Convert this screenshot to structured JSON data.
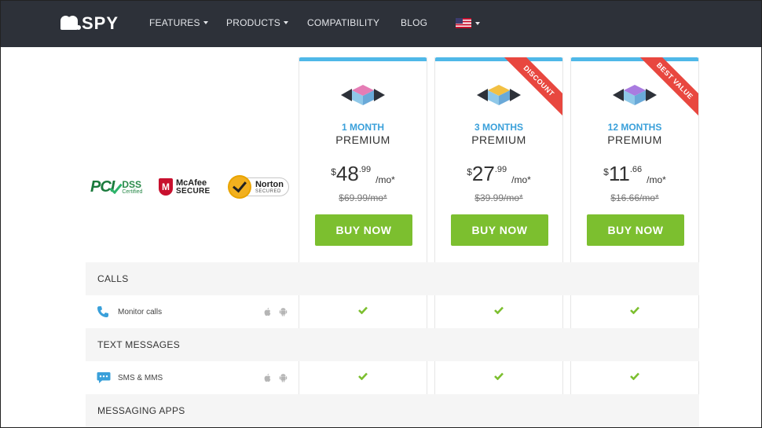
{
  "nav": {
    "logo": "SPY",
    "items": [
      {
        "label": "FEATURES",
        "dropdown": true
      },
      {
        "label": "PRODUCTS",
        "dropdown": true
      },
      {
        "label": "COMPATIBILITY",
        "dropdown": false
      },
      {
        "label": "BLOG",
        "dropdown": false
      }
    ],
    "language": "us-flag-icon"
  },
  "badges": {
    "pci": {
      "pc": "PCI",
      "dss": "DSS",
      "sub": "Certified"
    },
    "mcafee": {
      "mark": "M",
      "name": "McAfee",
      "sub": "SECURE"
    },
    "norton": {
      "name": "Norton",
      "sub": "SECURED"
    }
  },
  "plans": [
    {
      "period": "1 MONTH",
      "name": "PREMIUM",
      "currency": "$",
      "price_int": "48",
      "price_cents": ".99",
      "per": "/mo*",
      "old_price": "$69.99/mo*",
      "buy_label": "BUY NOW",
      "ribbon": "",
      "cube_top": "#e57db5",
      "cube_left": "#8fc8e8",
      "cube_right": "#6aa9d8"
    },
    {
      "period": "3 MONTHS",
      "name": "PREMIUM",
      "currency": "$",
      "price_int": "27",
      "price_cents": ".99",
      "per": "/mo*",
      "old_price": "$39.99/mo*",
      "buy_label": "BUY NOW",
      "ribbon": "DISCOUNT",
      "cube_top": "#f2c043",
      "cube_left": "#8fc8e8",
      "cube_right": "#6aa9d8"
    },
    {
      "period": "12 MONTHS",
      "name": "PREMIUM",
      "currency": "$",
      "price_int": "11",
      "price_cents": ".66",
      "per": "/mo*",
      "old_price": "$16.66/mo*",
      "buy_label": "BUY NOW",
      "ribbon": "BEST VALUE",
      "cube_top": "#a97be0",
      "cube_left": "#8fc8e8",
      "cube_right": "#6aa9d8"
    }
  ],
  "features": {
    "calls": {
      "section": "CALLS",
      "label": "Monitor calls"
    },
    "texts": {
      "section": "TEXT MESSAGES",
      "label": "SMS & MMS"
    },
    "messaging": {
      "section": "MESSAGING APPS"
    }
  },
  "colors": {
    "accent": "#4fb8e8",
    "buy": "#7cbf2f",
    "check": "#7cbf2f",
    "ribbon": "#e8473f"
  }
}
